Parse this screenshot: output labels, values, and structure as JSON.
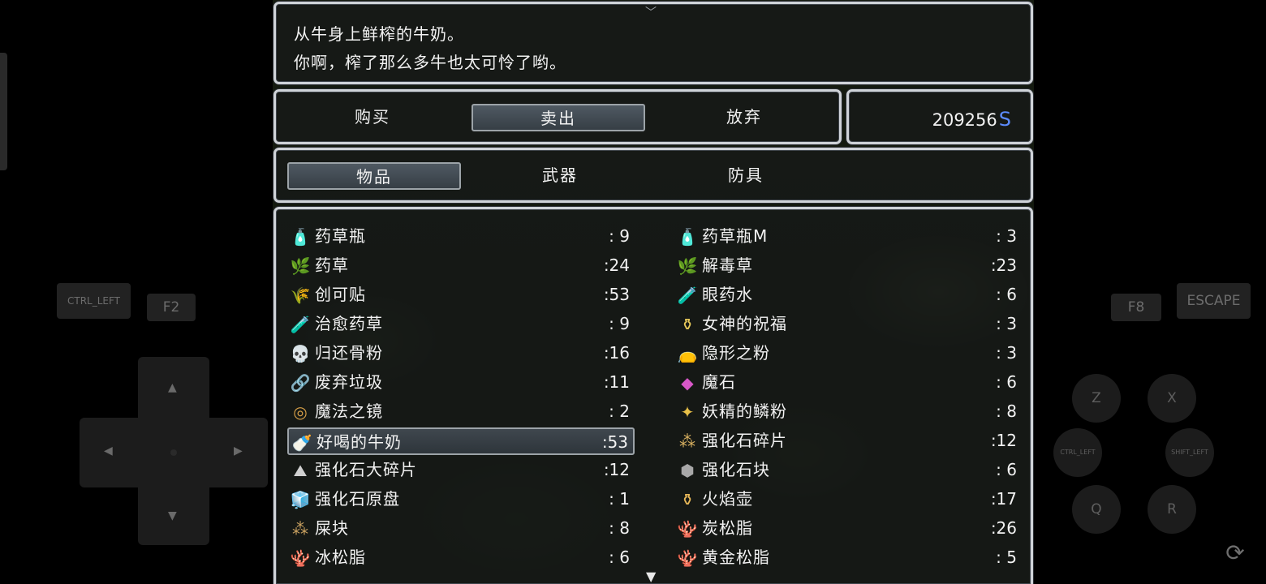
{
  "message": {
    "line1": "从牛身上鲜榨的牛奶。",
    "line2": "你啊，榨了那么多牛也太可怜了哟。"
  },
  "commands": {
    "buy": "购买",
    "sell": "卖出",
    "cancel": "放弃",
    "selected": "sell"
  },
  "gold": {
    "amount": "209256",
    "unit": "S"
  },
  "categories": {
    "items": "物品",
    "weapons": "武器",
    "armor": "防具",
    "selected": "items"
  },
  "inventory": [
    {
      "name": "药草瓶",
      "qty": ": 9",
      "icon": "potion-bottle-icon",
      "glyph": "🧴",
      "color": "#6fa4d8"
    },
    {
      "name": "药草瓶M",
      "qty": ": 3",
      "icon": "potion-bottle-m-icon",
      "glyph": "🧴",
      "color": "#8fa6c0"
    },
    {
      "name": "药草",
      "qty": ":24",
      "icon": "herb-icon",
      "glyph": "🌿",
      "color": "#3cc35a"
    },
    {
      "name": "解毒草",
      "qty": ":23",
      "icon": "antidote-herb-icon",
      "glyph": "🌿",
      "color": "#9ccc4a"
    },
    {
      "name": "创可贴",
      "qty": ":53",
      "icon": "bandage-icon",
      "glyph": "🌾",
      "color": "#88b842"
    },
    {
      "name": "眼药水",
      "qty": ": 6",
      "icon": "eyedrops-icon",
      "glyph": "🧪",
      "color": "#c8c8c8"
    },
    {
      "name": "治愈药草",
      "qty": ": 9",
      "icon": "healing-herb-icon",
      "glyph": "🧪",
      "color": "#7ad44a"
    },
    {
      "name": "女神的祝福",
      "qty": ": 3",
      "icon": "goddess-blessing-icon",
      "glyph": "⚱",
      "color": "#e8c95a"
    },
    {
      "name": "归还骨粉",
      "qty": ":16",
      "icon": "skull-icon",
      "glyph": "💀",
      "color": "#e8e8e8"
    },
    {
      "name": "隐形之粉",
      "qty": ": 3",
      "icon": "powder-pouch-icon",
      "glyph": "👝",
      "color": "#e09aa8"
    },
    {
      "name": "废弃垃圾",
      "qty": ":11",
      "icon": "junk-icon",
      "glyph": "🔗",
      "color": "#9a7ac8"
    },
    {
      "name": "魔石",
      "qty": ": 6",
      "icon": "magic-stone-icon",
      "glyph": "◆",
      "color": "#d858c8"
    },
    {
      "name": "魔法之镜",
      "qty": ": 2",
      "icon": "magic-mirror-icon",
      "glyph": "◎",
      "color": "#d8a048"
    },
    {
      "name": "妖精的鳞粉",
      "qty": ": 8",
      "icon": "fairy-dust-icon",
      "glyph": "✦",
      "color": "#e8c048"
    },
    {
      "name": "好喝的牛奶",
      "qty": ":53",
      "icon": "milk-bottle-icon",
      "glyph": "🍼",
      "color": "#f0a0b0"
    },
    {
      "name": "强化石碎片",
      "qty": ":12",
      "icon": "stone-fragment-icon",
      "glyph": "⁂",
      "color": "#d8b060"
    },
    {
      "name": "强化石大碎片",
      "qty": ":12",
      "icon": "large-stone-fragment-icon",
      "glyph": "⛰",
      "color": "#d0d0d0"
    },
    {
      "name": "强化石块",
      "qty": ": 6",
      "icon": "stone-block-icon",
      "glyph": "⬢",
      "color": "#a8a8a8"
    },
    {
      "name": "强化石原盘",
      "qty": ": 1",
      "icon": "stone-disc-icon",
      "glyph": "🧊",
      "color": "#8ec8f0"
    },
    {
      "name": "火焰壶",
      "qty": ":17",
      "icon": "fire-pot-icon",
      "glyph": "⚱",
      "color": "#e8b858"
    },
    {
      "name": "屎块",
      "qty": ": 8",
      "icon": "dung-icon",
      "glyph": "⁂",
      "color": "#c8a060"
    },
    {
      "name": "炭松脂",
      "qty": ":26",
      "icon": "charcoal-resin-icon",
      "glyph": "🪸",
      "color": "#d87060"
    },
    {
      "name": "冰松脂",
      "qty": ": 6",
      "icon": "ice-resin-icon",
      "glyph": "🪸",
      "color": "#d87060"
    },
    {
      "name": "黄金松脂",
      "qty": ": 5",
      "icon": "gold-resin-icon",
      "glyph": "🪸",
      "color": "#e07858"
    }
  ],
  "selected_item": "好喝的牛奶",
  "gamepad": {
    "ctrl_left": "CTRL_LEFT",
    "f2": "F2",
    "f8": "F8",
    "escape": "ESCAPE",
    "z": "Z",
    "x": "X",
    "ctrl_left_round": "CTRL_LEFT",
    "shift_left": "SHIFT_LEFT",
    "q": "Q",
    "r": "R"
  },
  "colors": {
    "window_border": "#cfd3d8",
    "gold_unit": "#5c8bff",
    "selection": "#4f5962"
  }
}
